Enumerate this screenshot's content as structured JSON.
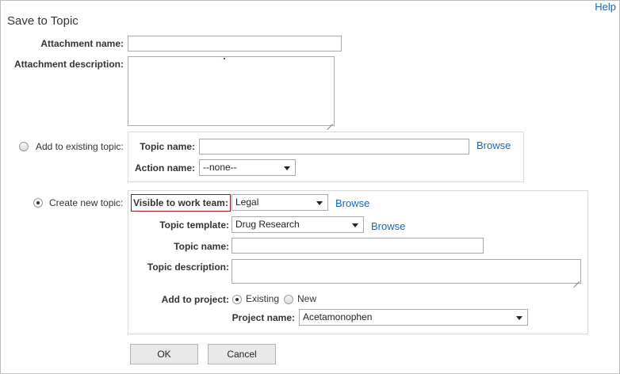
{
  "header": {
    "title": "Save to Topic",
    "help": "Help"
  },
  "attachment": {
    "name_label": "Attachment name:",
    "name_value": "",
    "description_label": "Attachment description:",
    "description_value": ""
  },
  "existing_topic": {
    "radio_label": "Add to existing topic:",
    "selected": false,
    "topic_name_label": "Topic name:",
    "topic_name_value": "",
    "browse": "Browse",
    "action_name_label": "Action name:",
    "action_name_value": "--none--"
  },
  "new_topic": {
    "radio_label": "Create new topic:",
    "selected": true,
    "visible_label": "Visible to work team:",
    "visible_value": "Legal",
    "visible_browse": "Browse",
    "template_label": "Topic template:",
    "template_value": "Drug Research",
    "template_browse": "Browse",
    "topic_name_label": "Topic name:",
    "topic_name_value": "",
    "topic_description_label": "Topic description:",
    "topic_description_value": "",
    "add_to_project_label": "Add to project:",
    "project_option_existing": "Existing",
    "project_option_new": "New",
    "project_option_selected": "Existing",
    "project_name_label": "Project name:",
    "project_name_value": "Acetamonophen"
  },
  "buttons": {
    "ok": "OK",
    "cancel": "Cancel"
  }
}
